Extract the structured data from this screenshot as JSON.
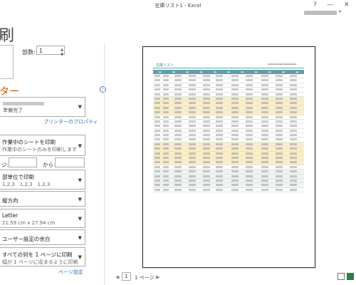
{
  "window": {
    "title": "在庫リスト1 - Excel",
    "help_label": "?",
    "minimize_label": "—",
    "close_label": "✕"
  },
  "backstage": {
    "heading": "刷",
    "copies_label": "部数:",
    "copies_value": "1",
    "printer_section_title": "ター",
    "printer_status": "準備完了",
    "printer_properties_link": "プリンターのプロパティ",
    "page_setup_link": "ページ設定"
  },
  "settings": [
    {
      "line1": "作業中のシートを印刷",
      "line2": "作業中のシートのみを印刷します"
    },
    {
      "line1": "部単位で印刷",
      "line2": "1,2,3　1,2,3　1,2,3"
    },
    {
      "line1": "縦方向",
      "line2": ""
    },
    {
      "line1": "Letter",
      "line2": "21.59 cm x 27.94 cm"
    },
    {
      "line1": "ユーザー設定の余白",
      "line2": ""
    },
    {
      "line1": "すべての列を 1 ページに印刷",
      "line2": "幅が 1 ページに収まるように印刷"
    }
  ],
  "pages": {
    "label": "ジ:",
    "to_label": "から"
  },
  "preview": {
    "sheet_title": "在庫リスト",
    "current_page": "1",
    "total_pages": "1 ページ",
    "prev_arrow": "◀",
    "next_arrow": "▶"
  }
}
